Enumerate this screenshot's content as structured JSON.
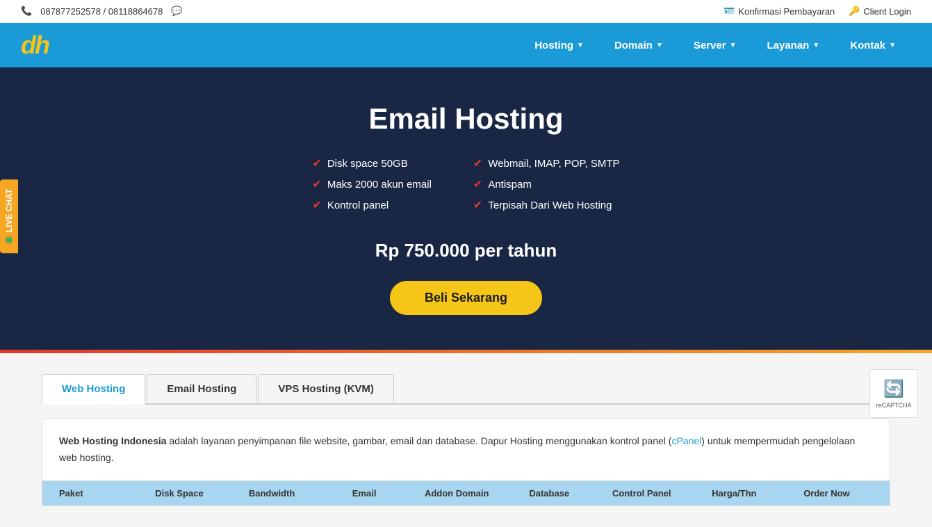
{
  "topbar": {
    "phone": "087877252578 / 08118864678",
    "konfirmasi": "Konfirmasi Pembayaran",
    "clientlogin": "Client Login"
  },
  "navbar": {
    "logo": "dh",
    "links": [
      {
        "label": "Hosting",
        "has_arrow": true
      },
      {
        "label": "Domain",
        "has_arrow": true
      },
      {
        "label": "Server",
        "has_arrow": true
      },
      {
        "label": "Layanan",
        "has_arrow": true
      },
      {
        "label": "Kontak",
        "has_arrow": true
      }
    ]
  },
  "hero": {
    "title": "Email Hosting",
    "features_left": [
      "Disk space 50GB",
      "Maks 2000 akun email",
      "Kontrol panel"
    ],
    "features_right": [
      "Webmail, IMAP, POP, SMTP",
      "Antispam",
      "Terpisah Dari Web Hosting"
    ],
    "price": "Rp 750.000 per tahun",
    "btn_label": "Beli Sekarang"
  },
  "tabs": [
    {
      "label": "Web Hosting",
      "active": true
    },
    {
      "label": "Email Hosting",
      "active": false
    },
    {
      "label": "VPS Hosting (KVM)",
      "active": false
    }
  ],
  "description": {
    "bold": "Web Hosting Indonesia",
    "text1": " adalah layanan penyimpanan file website, gambar, email dan database. Dapur Hosting menggunakan kontrol panel (",
    "link": "cPanel",
    "text2": ") untuk mempermudah pengelolaan web hosting."
  },
  "table_headers": [
    "Paket",
    "Disk Space",
    "Bandwidth",
    "Email",
    "Addon Domain",
    "Database",
    "Control Panel",
    "Harga/Thn",
    "Order Now"
  ],
  "live_chat": {
    "label": "LIVE CHAT"
  },
  "recaptcha": {
    "label": "reCAPTCHA"
  }
}
